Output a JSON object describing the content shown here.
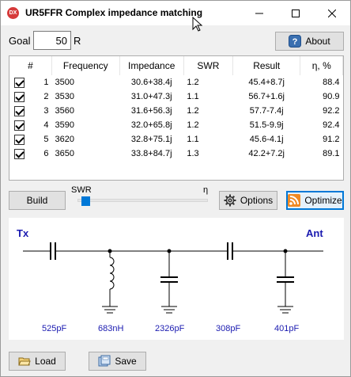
{
  "window": {
    "title": "UR5FFR Complex impedance matching",
    "icon_text": "DX"
  },
  "goal": {
    "label": "Goal",
    "value": "50",
    "unit": "R"
  },
  "about_label": "About",
  "table": {
    "headers": [
      "#",
      "Frequency",
      "Impedance",
      "SWR",
      "Result",
      "η, %"
    ],
    "rows": [
      {
        "checked": true,
        "n": "1",
        "freq": "3500",
        "imp": "30.6+38.4j",
        "swr": "1.2",
        "result": "45.4+8.7j",
        "eta": "88.4"
      },
      {
        "checked": true,
        "n": "2",
        "freq": "3530",
        "imp": "31.0+47.3j",
        "swr": "1.1",
        "result": "56.7+1.6j",
        "eta": "90.9"
      },
      {
        "checked": true,
        "n": "3",
        "freq": "3560",
        "imp": "31.6+56.3j",
        "swr": "1.2",
        "result": "57.7-7.4j",
        "eta": "92.2"
      },
      {
        "checked": true,
        "n": "4",
        "freq": "3590",
        "imp": "32.0+65.8j",
        "swr": "1.2",
        "result": "51.5-9.9j",
        "eta": "92.4"
      },
      {
        "checked": true,
        "n": "5",
        "freq": "3620",
        "imp": "32.8+75.1j",
        "swr": "1.1",
        "result": "45.6-4.1j",
        "eta": "91.2"
      },
      {
        "checked": true,
        "n": "6",
        "freq": "3650",
        "imp": "33.8+84.7j",
        "swr": "1.3",
        "result": "42.2+7.2j",
        "eta": "89.1"
      }
    ]
  },
  "controls": {
    "build_label": "Build",
    "slider_left": "SWR",
    "slider_right": "η",
    "slider_position": 0.03,
    "options_label": "Options",
    "optimize_label": "Optimize"
  },
  "schematic": {
    "tx_label": "Tx",
    "ant_label": "Ant",
    "components": [
      "525pF",
      "683nH",
      "2326pF",
      "308pF",
      "401pF"
    ]
  },
  "footer": {
    "load_label": "Load",
    "save_label": "Save"
  },
  "colors": {
    "accent": "#0078d7",
    "schematic_text": "#1a1ab0",
    "app_icon": "#d63a3a",
    "optimize_icon": "#f08a24"
  }
}
